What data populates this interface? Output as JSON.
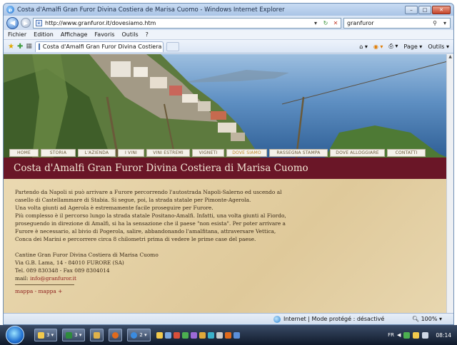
{
  "window": {
    "title": "Costa d'Amalfi Gran Furor Divina Costiera de Marisa Cuomo - Windows Internet Explorer",
    "minimize": "–",
    "maximize": "□",
    "close": "✕"
  },
  "address": {
    "url": "http://www.granfuror.it/dovesiamo.htm",
    "search_value": "granfuror"
  },
  "menu": [
    "Fichier",
    "Edition",
    "Affichage",
    "Favoris",
    "Outils",
    "?"
  ],
  "tab": {
    "label": "Costa d'Amalfi Gran Furor Divina Costiera di Mari...",
    "tools": [
      "Page ▾",
      "Outils ▾"
    ]
  },
  "site": {
    "nav": [
      {
        "label": "HOME",
        "active": false
      },
      {
        "label": "STORIA",
        "active": false
      },
      {
        "label": "L'AZIENDA",
        "active": false
      },
      {
        "label": "I VINI",
        "active": false
      },
      {
        "label": "VINI ESTREMI",
        "active": false
      },
      {
        "label": "VIGNETI",
        "active": false
      },
      {
        "label": "DOVE SIAMO",
        "active": true
      },
      {
        "label": "RASSEGNA STAMPA",
        "active": false
      },
      {
        "label": "DOVE ALLOGGIARE",
        "active": false
      },
      {
        "label": "CONTATTI",
        "active": false
      }
    ],
    "banner_title": "Costa d'Amalfi Gran Furor Divina Costiera di Marisa Cuomo",
    "paragraph_1": [
      "Partendo da Napoli si può arrivare a Furore percorrendo l'autostrada Napoli-Salerno ed uscendo al",
      "casello di Castellammare di Stabia. Si segue, poi, la strada statale per Pimonte-Agerola.",
      "Una volta giunti ad Agerola è estremamente facile proseguire per Furore.",
      "Più complesso è il percorso lungo la strada statale Positano-Amalfi. Infatti, una volta giunti al Fiordo,",
      "proseguendo in direzione di Amalfi, si ha la sensazione che il paese \"non esista\". Per poter arrivare a",
      "Furore è necessario, al bivio di Pogerola, salire, abbandonando l'amalfitana, attraversare Vettica,",
      "Conca dei Marini e percorrere circa 8 chilometri prima di vedere le prime case del paese."
    ],
    "address_lines": [
      "Cantine Gran Furor Divina Costiera di Marisa Cuomo",
      "Via G.B. Lama, 14 - 84010 FURORE (SA)",
      "Tel. 089 830348 - Fax 089 8304014"
    ],
    "mail_label": "mail: ",
    "mail_value": "info@granfuror.it",
    "map_links": "mappa - mappa +"
  },
  "status": {
    "zone": "Internet | Mode protégé : désactivé",
    "zoom": "100%"
  },
  "taskbar": {
    "buttons": [
      "3 ▾",
      "3 ▾",
      "",
      "",
      "2 ▾"
    ],
    "lang": "FR",
    "clock": "08:14"
  }
}
